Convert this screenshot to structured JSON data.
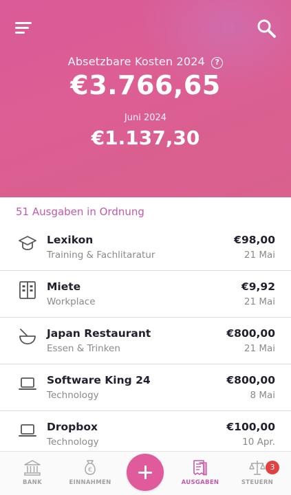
{
  "header": {
    "title": "Absetzbare Kosten 2024",
    "help_glyph": "?",
    "total": "€3.766,65",
    "month_label": "Juni 2024",
    "month_total": "€1.137,30"
  },
  "summary": "51 Ausgaben in Ordnung",
  "expenses": [
    {
      "name": "Lexikon",
      "category": "Training & Fachlitaratur",
      "amount": "€98,00",
      "date": "21 Mai",
      "icon": "graduation-cap-icon"
    },
    {
      "name": "Miete",
      "category": "Workplace",
      "amount": "€9,92",
      "date": "21 Mai",
      "icon": "building-icon"
    },
    {
      "name": "Japan Restaurant",
      "category": "Essen & Trinken",
      "amount": "€800,00",
      "date": "21 Mai",
      "icon": "bowl-icon"
    },
    {
      "name": "Software King 24",
      "category": "Technology",
      "amount": "€800,00",
      "date": "8 Mai",
      "icon": "laptop-icon"
    },
    {
      "name": "Dropbox",
      "category": "Technology",
      "amount": "€100,00",
      "date": "10 Apr.",
      "icon": "laptop-icon"
    }
  ],
  "nav": {
    "bank": "BANK",
    "einnahmen": "EINNAHMEN",
    "ausgaben": "AUSGABEN",
    "steuern": "STEUERN",
    "steuern_badge": "3"
  },
  "colors": {
    "header_gradient_start": "#d95b98",
    "accent": "#c15aa8",
    "fab": "#e05b9c",
    "badge": "#e0433f"
  }
}
